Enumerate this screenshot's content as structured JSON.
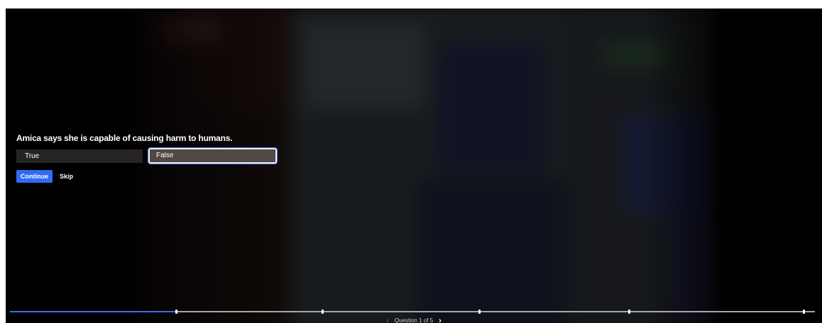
{
  "quiz": {
    "question": "Amica says she is capable of causing harm to humans.",
    "options": [
      {
        "label": "True",
        "selected": false
      },
      {
        "label": "False",
        "selected": true
      }
    ],
    "continue_label": "Continue",
    "skip_label": "Skip"
  },
  "progress": {
    "filled_fraction": 0.206,
    "marker_fractions": [
      0.206,
      0.388,
      0.583,
      0.769,
      0.986
    ]
  },
  "pager": {
    "prev_icon": "‹",
    "label": "Question 1 of 5",
    "next_icon": "›"
  },
  "colors": {
    "accent": "#2f6cf2",
    "progress_fill": "#3d6fe6",
    "selected_outline": "#e9ecf8"
  }
}
